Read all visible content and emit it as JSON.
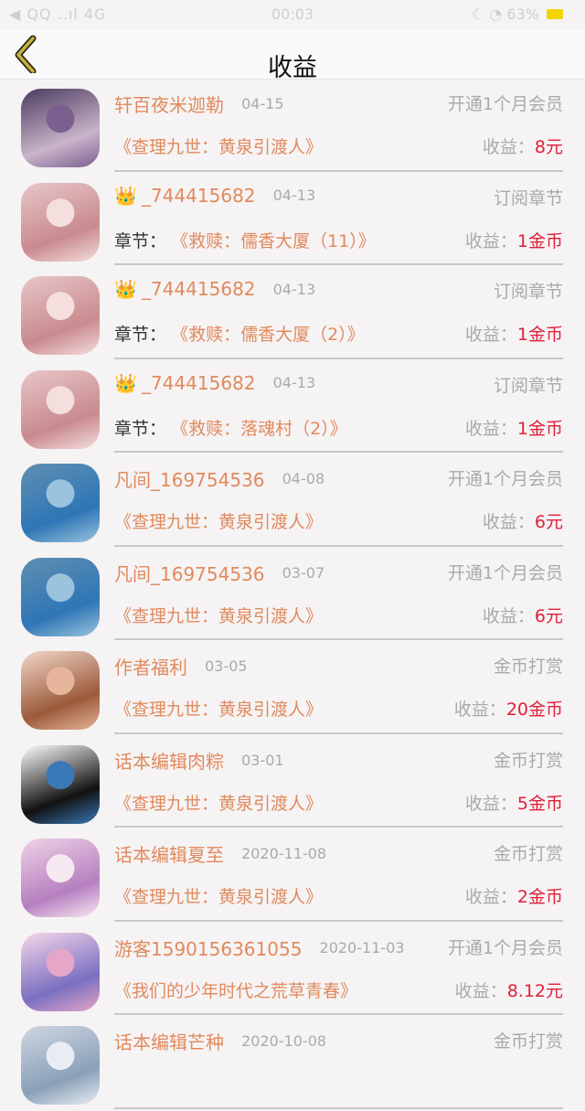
{
  "status_bar": {
    "left": "◀ QQ ..ıl 4G",
    "time": "00:03",
    "right": "☾ ◔ 63%",
    "battery_color": "#f3d400"
  },
  "navbar": {
    "title": "收益",
    "back_icon": "chevron-left-icon",
    "back_color": "#9a8b1a"
  },
  "colors": {
    "name": "#e08a5d",
    "amount": "#e0203a",
    "muted": "#aaa"
  },
  "rows": [
    {
      "name": "轩百夜米迦勒",
      "crown": "",
      "date": "04-15",
      "type": "开通1个月会员",
      "prefix": "",
      "book": "《查理九世：黄泉引渡人》",
      "earn_label": "收益：",
      "amount": "8元",
      "avatar": [
        "#4a3b5e",
        "#c9b4c9",
        "#7a5f8f"
      ]
    },
    {
      "name": "_744415682",
      "crown": "👑",
      "date": "04-13",
      "type": "订阅章节",
      "prefix": "章节：",
      "book": "《救赎：儒香大厦（11）》",
      "earn_label": "收益：",
      "amount": "1金币",
      "avatar": [
        "#e8c7c9",
        "#c98a8e",
        "#f4dede"
      ]
    },
    {
      "name": "_744415682",
      "crown": "👑",
      "date": "04-13",
      "type": "订阅章节",
      "prefix": "章节：",
      "book": "《救赎：儒香大厦（2）》",
      "earn_label": "收益：",
      "amount": "1金币",
      "avatar": [
        "#e8c7c9",
        "#c98a8e",
        "#f4dede"
      ]
    },
    {
      "name": "_744415682",
      "crown": "👑",
      "date": "04-13",
      "type": "订阅章节",
      "prefix": "章节：",
      "book": "《救赎：落魂村（2）》",
      "earn_label": "收益：",
      "amount": "1金币",
      "avatar": [
        "#e8c7c9",
        "#c98a8e",
        "#f4dede"
      ]
    },
    {
      "name": "凡间_169754536",
      "crown": "",
      "date": "04-08",
      "type": "开通1个月会员",
      "prefix": "",
      "book": "《查理九世：黄泉引渡人》",
      "earn_label": "收益：",
      "amount": "6元",
      "avatar": [
        "#5f8fb1",
        "#2e76b6",
        "#9cc3dd"
      ]
    },
    {
      "name": "凡间_169754536",
      "crown": "",
      "date": "03-07",
      "type": "开通1个月会员",
      "prefix": "",
      "book": "《查理九世：黄泉引渡人》",
      "earn_label": "收益：",
      "amount": "6元",
      "avatar": [
        "#5f8fb1",
        "#2e76b6",
        "#9cc3dd"
      ]
    },
    {
      "name": "作者福利",
      "crown": "",
      "date": "03-05",
      "type": "金币打赏",
      "prefix": "",
      "book": "《查理九世：黄泉引渡人》",
      "earn_label": "收益：",
      "amount": "20金币",
      "avatar": [
        "#f2d7c9",
        "#9b5a3a",
        "#e7b59b"
      ]
    },
    {
      "name": "话本编辑肉粽",
      "crown": "",
      "date": "03-01",
      "type": "金币打赏",
      "prefix": "",
      "book": "《查理九世：黄泉引渡人》",
      "earn_label": "收益：",
      "amount": "5金币",
      "avatar": [
        "#ffffff",
        "#111111",
        "#3a79b8"
      ]
    },
    {
      "name": "话本编辑夏至",
      "crown": "",
      "date": "2020-11-08",
      "type": "金币打赏",
      "prefix": "",
      "book": "《查理九世：黄泉引渡人》",
      "earn_label": "收益：",
      "amount": "2金币",
      "avatar": [
        "#efd2e6",
        "#b67fc0",
        "#f7e9f1"
      ]
    },
    {
      "name": "游客1590156361055",
      "crown": "",
      "date": "2020-11-03",
      "type": "开通1个月会员",
      "prefix": "",
      "book": "《我们的少年时代之荒草青春》",
      "earn_label": "收益：",
      "amount": "8.12元",
      "avatar": [
        "#f6d7ea",
        "#7a6fc0",
        "#e5a6c8"
      ]
    },
    {
      "name": "话本编辑芒种",
      "crown": "",
      "date": "2020-10-08",
      "type": "金币打赏",
      "prefix": "",
      "book": "",
      "earn_label": "",
      "amount": "",
      "avatar": [
        "#cfd6e2",
        "#8aa0b8",
        "#e9edf3"
      ]
    }
  ]
}
